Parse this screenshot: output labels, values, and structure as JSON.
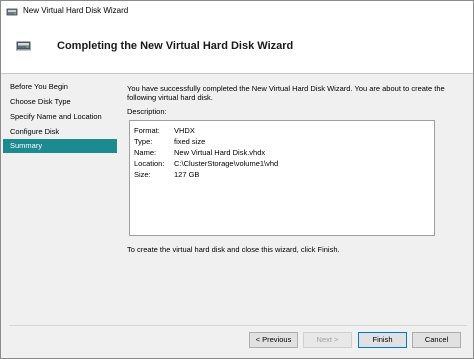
{
  "window": {
    "title": "New Virtual Hard Disk Wizard"
  },
  "header": {
    "title": "Completing the New Virtual Hard Disk Wizard",
    "icon": "virtual-disk-icon"
  },
  "nav": {
    "items": [
      {
        "label": "Before You Begin",
        "active": false
      },
      {
        "label": "Choose Disk Type",
        "active": false
      },
      {
        "label": "Specify Name and Location",
        "active": false
      },
      {
        "label": "Configure Disk",
        "active": false
      },
      {
        "label": "Summary",
        "active": true
      }
    ]
  },
  "main": {
    "intro": "You have successfully completed the New Virtual Hard Disk Wizard. You are about to create the following virtual hard disk.",
    "description_label": "Description:",
    "properties": [
      {
        "name": "Format:",
        "value": "VHDX"
      },
      {
        "name": "Type:",
        "value": "fixed size"
      },
      {
        "name": "Name:",
        "value": "New Virtual Hard Disk.vhdx"
      },
      {
        "name": "Location:",
        "value": "C:\\ClusterStorage\\volume1\\vhd"
      },
      {
        "name": "Size:",
        "value": "127 GB"
      }
    ],
    "finish_note": "To create the virtual hard disk and close this wizard, click Finish."
  },
  "buttons": {
    "previous": "< Previous",
    "next": "Next >",
    "finish": "Finish",
    "cancel": "Cancel"
  },
  "colors": {
    "active_nav": "#1c8a8e",
    "content_bg": "#f0f0f0",
    "focus_border": "#0078d7"
  }
}
